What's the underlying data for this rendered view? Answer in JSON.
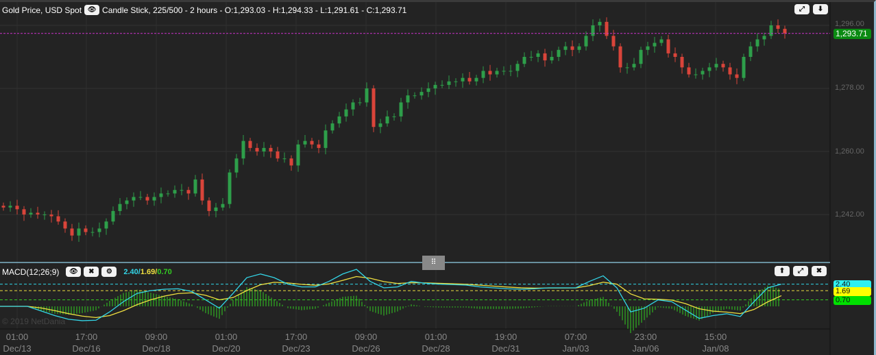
{
  "header": {
    "instrument": "Gold Price, USD Spot",
    "info": "Candle Stick, 225/500 - 2 hours - O:1,293.03 - H:1,294.33 - L:1,291.61 - C:1,293.71"
  },
  "macd_header": {
    "label": "MACD(12;26;9)",
    "macd": "2.40",
    "signal": "1.69",
    "hist": "0.70",
    "sep": "/"
  },
  "copyright": "© 2019 NetDania",
  "price_axis": [
    "1,296.00",
    "1,278.00",
    "1,260.00",
    "1,242.00"
  ],
  "current_price": "1,293.71",
  "macd_badges": [
    "2.40",
    "1.69",
    "0.70"
  ],
  "time_axis": [
    {
      "t": "01:00",
      "d": "Dec/13"
    },
    {
      "t": "17:00",
      "d": "Dec/16"
    },
    {
      "t": "09:00",
      "d": "Dec/18"
    },
    {
      "t": "01:00",
      "d": "Dec/20"
    },
    {
      "t": "17:00",
      "d": "Dec/23"
    },
    {
      "t": "09:00",
      "d": "Dec/26"
    },
    {
      "t": "01:00",
      "d": "Dec/28"
    },
    {
      "t": "19:00",
      "d": "Dec/31"
    },
    {
      "t": "07:00",
      "d": "Jan/03"
    },
    {
      "t": "23:00",
      "d": "Jan/06"
    },
    {
      "t": "15:00",
      "d": "Jan/08"
    }
  ],
  "colors": {
    "up": "#2e9e4a",
    "down": "#d9443a",
    "macd": "#33d6e8",
    "signal": "#f0e040",
    "hist": "#33cc22",
    "price_line": "#cc33cc"
  },
  "chart_data": {
    "type": "candlestick",
    "title": "Gold Price, USD Spot",
    "ylim": [
      1232,
      1300
    ],
    "yticks": [
      1242,
      1260,
      1278,
      1296
    ],
    "last": {
      "open": 1293.03,
      "high": 1294.33,
      "low": 1291.61,
      "close": 1293.71
    },
    "closes": [
      1244,
      1244.5,
      1243.5,
      1242,
      1242.5,
      1242,
      1242,
      1241.5,
      1240,
      1238,
      1236,
      1238,
      1237,
      1237,
      1238,
      1240,
      1243,
      1245,
      1246,
      1247,
      1247,
      1246,
      1247,
      1248,
      1248,
      1249,
      1249,
      1248,
      1252,
      1246,
      1243,
      1244,
      1245,
      1254,
      1258,
      1263,
      1261,
      1260,
      1261,
      1260,
      1258,
      1258,
      1256,
      1262,
      1263,
      1262,
      1261,
      1266,
      1268,
      1270,
      1272,
      1274,
      1274,
      1278,
      1267,
      1268,
      1270,
      1270,
      1274,
      1276,
      1276,
      1277,
      1278,
      1279,
      1279,
      1280,
      1280,
      1281,
      1280,
      1281,
      1283,
      1282,
      1283,
      1283,
      1283,
      1285,
      1287,
      1287,
      1288,
      1286,
      1287,
      1289,
      1290,
      1289,
      1290,
      1293,
      1296,
      1297,
      1293,
      1290,
      1284,
      1284,
      1285,
      1289,
      1290,
      1291,
      1292,
      1288,
      1287,
      1284,
      1282,
      1282,
      1283,
      1284,
      1285,
      1284,
      1282,
      1281,
      1287,
      1290,
      1292,
      1293,
      1296,
      1295,
      1293.71
    ],
    "macd": {
      "name": "MACD(12;26;9)",
      "values": [
        0,
        0,
        0,
        -0.5,
        -1,
        -1.4,
        -1.55,
        -1.5,
        -0.6,
        0.5,
        1.4,
        1.7,
        1.85,
        1.9,
        1.6,
        0.7,
        -0.2,
        1.4,
        3.1,
        3.5,
        3.1,
        2.4,
        2.1,
        2.1,
        2.7,
        3.5,
        4.0,
        2.7,
        2.0,
        2.1,
        2.7,
        2.5,
        2.4,
        2.35,
        2.3,
        2.1,
        2.0,
        1.9,
        1.85,
        1.9,
        2.0,
        2.0,
        2.0,
        2.7,
        3.3,
        2.0,
        -0.6,
        -0.2,
        0.7,
        0.5,
        -0.4,
        -1.3,
        -1.0,
        -0.8,
        -1.1,
        0.5,
        2.0,
        2.4
      ],
      "levels": [
        2.4,
        1.69,
        0.7
      ],
      "ylim": [
        -2.5,
        5
      ]
    }
  }
}
